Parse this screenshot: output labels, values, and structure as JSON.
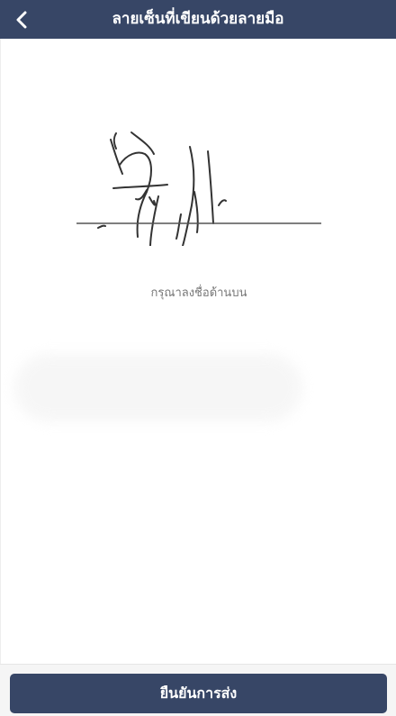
{
  "header": {
    "back_icon": "chevron-left-icon",
    "title": "ลายเซ็นที่เขียนด้วยลายมือ"
  },
  "signature": {
    "hint": "กรุณาลงชื่อด้านบน"
  },
  "footer": {
    "confirm_label": "ยืนยันการส่ง"
  },
  "colors": {
    "header_bg": "#374666",
    "button_bg": "#374666",
    "ink": "#333333",
    "hint_text": "#777777"
  }
}
